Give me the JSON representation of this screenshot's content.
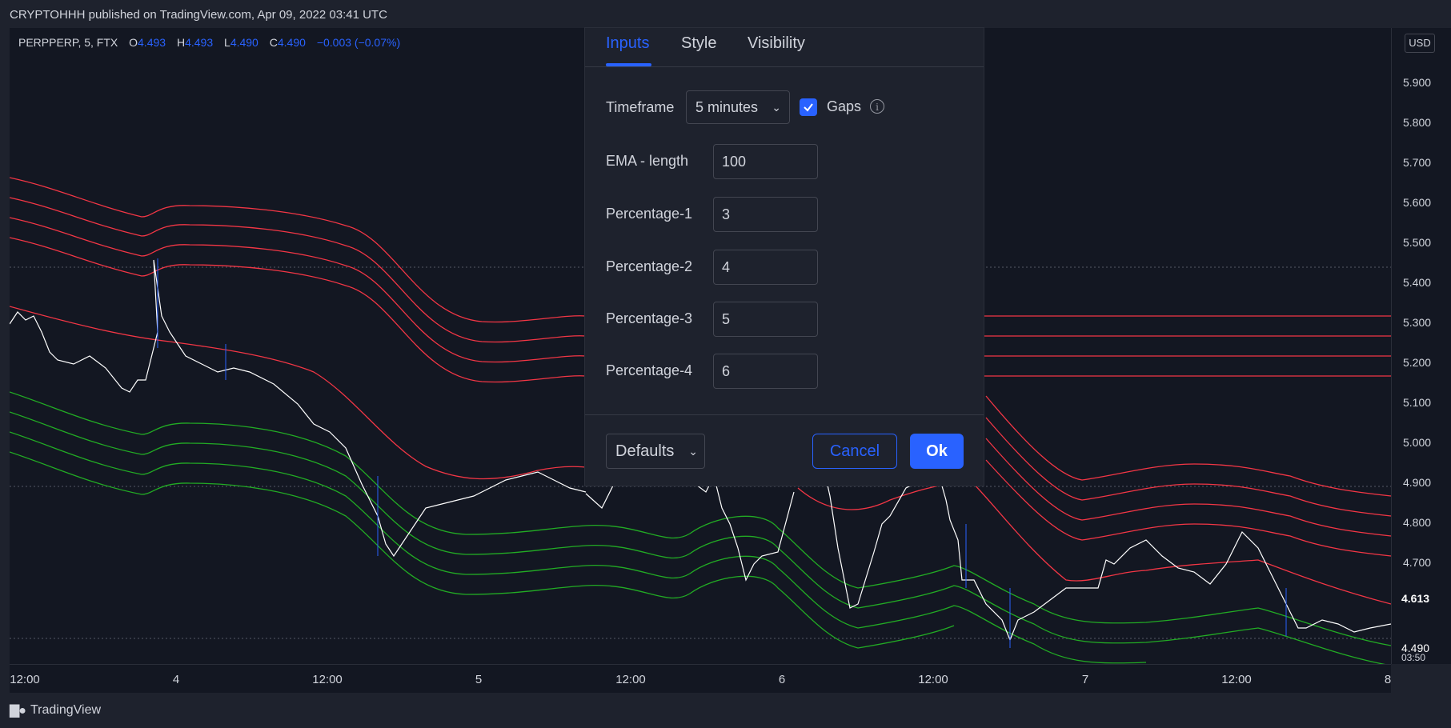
{
  "header": {
    "published": "CRYPTOHHH published on TradingView.com, Apr 09, 2022 03:41 UTC"
  },
  "legend": {
    "symbol": "PERPPERP, 5, FTX",
    "open_label": "O",
    "open": "4.493",
    "high_label": "H",
    "high": "4.493",
    "low_label": "L",
    "low": "4.490",
    "close_label": "C",
    "close": "4.490",
    "change": "−0.003 (−0.07%)"
  },
  "price_axis": {
    "currency": "USD",
    "ticks": [
      "5.900",
      "5.800",
      "5.700",
      "5.600",
      "5.500",
      "5.400",
      "5.300",
      "5.200",
      "5.100",
      "5.000",
      "4.900",
      "4.800",
      "4.700"
    ],
    "last_price": "4.613",
    "current_price": "4.490",
    "countdown": "03:50"
  },
  "time_axis": {
    "ticks": [
      "12:00",
      "4",
      "12:00",
      "5",
      "12:00",
      "6",
      "12:00",
      "7",
      "12:00",
      "8"
    ]
  },
  "brand": {
    "name": "TradingView"
  },
  "dialog": {
    "tabs": [
      "Inputs",
      "Style",
      "Visibility"
    ],
    "timeframe_label": "Timeframe",
    "timeframe_value": "5 minutes",
    "gaps_label": "Gaps",
    "gaps_checked": true,
    "fields": [
      {
        "label": "EMA - length",
        "value": "100"
      },
      {
        "label": "Percentage-1",
        "value": "3"
      },
      {
        "label": "Percentage-2",
        "value": "4"
      },
      {
        "label": "Percentage-3",
        "value": "5"
      },
      {
        "label": "Percentage-4",
        "value": "6"
      }
    ],
    "defaults_label": "Defaults",
    "cancel_label": "Cancel",
    "ok_label": "Ok"
  },
  "colors": {
    "accent": "#2962ff",
    "bands_upper": "#f23645",
    "bands_lower": "#22ab24",
    "candles": "#ffffff"
  }
}
